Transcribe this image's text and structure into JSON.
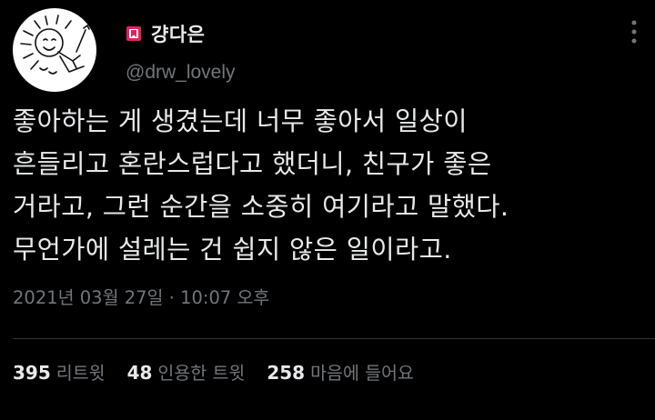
{
  "author": {
    "display_name": "걍다은",
    "handle": "@drw_lovely",
    "badge_icon": "red-bookmark-badge-icon"
  },
  "tweet": {
    "lines": [
      "좋아하는 게 생겼는데 너무 좋아서 일상이",
      "흔들리고 혼란스럽다고 했더니, 친구가 좋은",
      "거라고, 그런 순간을 소중히 여기라고 말했다.",
      "무언가에 설레는 건 쉽지 않은 일이라고."
    ],
    "timestamp": "2021년 03월 27일 · 10:07 오후"
  },
  "stats": {
    "retweets_count": "395",
    "retweets_label": "리트윗",
    "quotes_count": "48",
    "quotes_label": "인용한 트윗",
    "likes_count": "258",
    "likes_label": "마음에 들어요"
  },
  "colors": {
    "background": "#000000",
    "text_primary": "#e7e9ea",
    "text_secondary": "#71767b",
    "divider": "#2f3336",
    "badge_red": "#e0245e"
  }
}
